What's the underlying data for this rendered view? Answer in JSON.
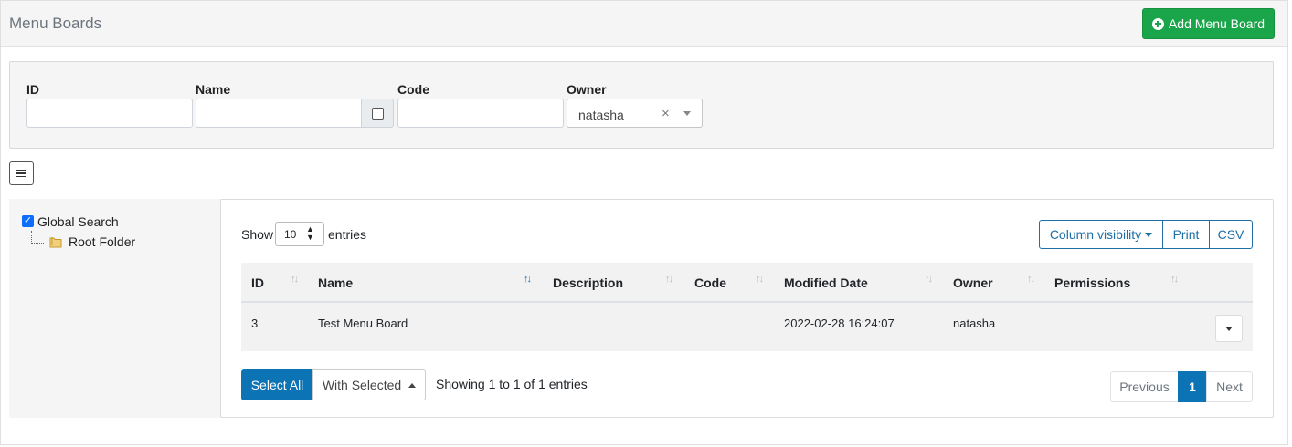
{
  "header": {
    "title": "Menu Boards",
    "add_button_label": "Add Menu Board"
  },
  "filters": {
    "id_label": "ID",
    "id_value": "",
    "name_label": "Name",
    "name_value": "",
    "name_exact_checked": false,
    "code_label": "Code",
    "code_value": "",
    "owner_label": "Owner",
    "owner_value": "natasha",
    "owner_clear": "×"
  },
  "tree": {
    "items": [
      {
        "label": "Global Search",
        "checked": true,
        "icon": "checkbox-icon"
      },
      {
        "label": "Root Folder",
        "icon": "folder-icon"
      }
    ]
  },
  "table": {
    "show_label": "Show",
    "page_length": "10",
    "entries_label": "entries",
    "toolbar": {
      "column_visibility": "Column visibility",
      "print": "Print",
      "csv": "CSV"
    },
    "columns": [
      "ID",
      "Name",
      "Description",
      "Code",
      "Modified Date",
      "Owner",
      "Permissions"
    ],
    "sort_icon": "↑↓",
    "rows": [
      {
        "id": "3",
        "name": "Test Menu Board",
        "description": "",
        "code": "",
        "modified": "2022-02-28 16:24:07",
        "owner": "natasha",
        "permissions": ""
      }
    ],
    "footer": {
      "select_all": "Select All",
      "with_selected": "With Selected",
      "info": "Showing 1 to 1 of 1 entries",
      "pagination": {
        "previous": "Previous",
        "current": "1",
        "next": "Next"
      }
    }
  },
  "colors": {
    "primary": "#0c73b5",
    "success": "#1aa54a",
    "panel_bg": "#f5f5f5"
  }
}
